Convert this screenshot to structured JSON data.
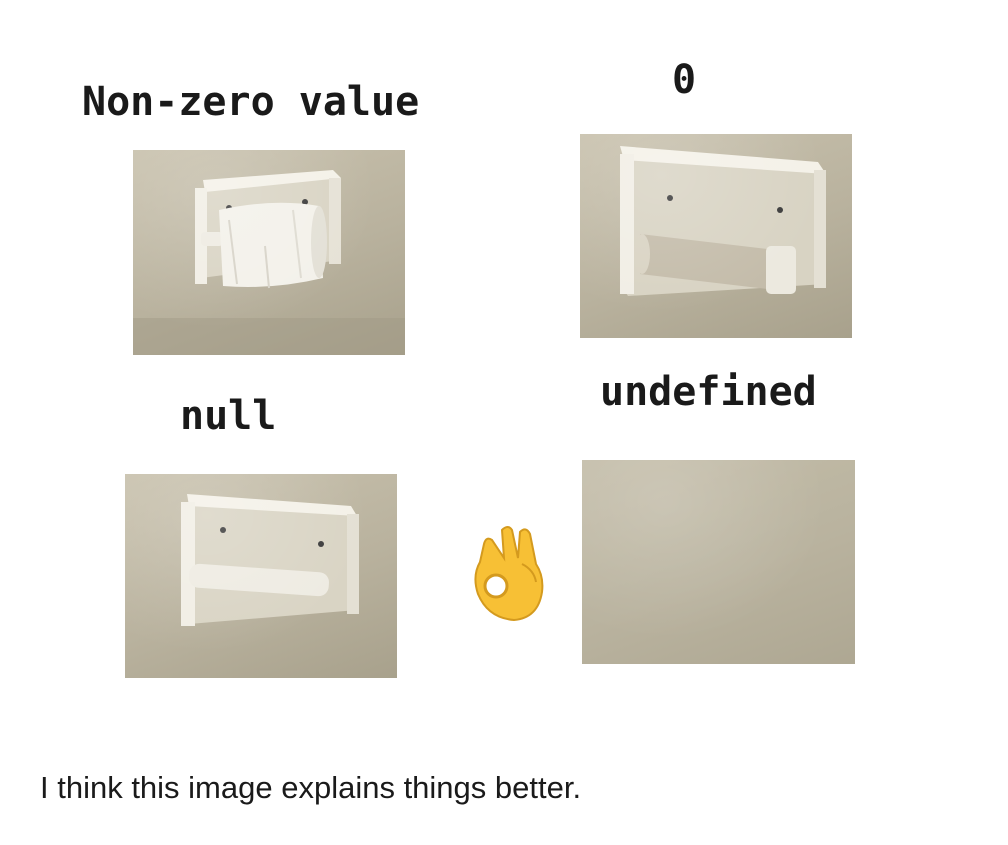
{
  "panels": {
    "nonzero": {
      "label": "Non-zero value",
      "image_icon": "full-toilet-paper-roll-icon"
    },
    "zero": {
      "label": "0",
      "image_icon": "empty-cardboard-tube-icon"
    },
    "null": {
      "label": "null",
      "image_icon": "empty-holder-icon"
    },
    "undefined": {
      "label": "undefined",
      "image_icon": "bare-wall-icon"
    }
  },
  "reaction_icon": "ok-hand-emoji-icon",
  "caption": "I think this image explains things better.",
  "colors": {
    "wall": "#bdb6a1",
    "holder": "#f2efe6",
    "text": "#1a1a1a",
    "emoji": "#f7c035"
  }
}
